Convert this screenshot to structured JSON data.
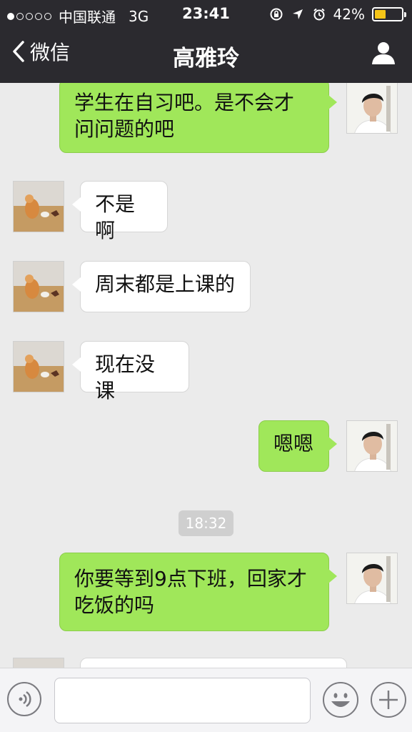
{
  "status_bar": {
    "carrier": "中国联通",
    "network": "3G",
    "time": "23:41",
    "battery": "42%",
    "battery_level": 0.42
  },
  "nav": {
    "back_label": "微信",
    "title": "高雅玲"
  },
  "messages": [
    {
      "side": "out",
      "text_lines": [
        "学生在自习吧。是不会才",
        "问问题的吧"
      ]
    },
    {
      "side": "in",
      "text": "不是啊"
    },
    {
      "side": "in",
      "text": "周末都是上课的"
    },
    {
      "side": "in",
      "text": "现在没课"
    },
    {
      "side": "out",
      "text": "嗯嗯"
    },
    {
      "side": "out",
      "text_lines": [
        "你要等到9点下班，回家才",
        "吃饭的吗"
      ]
    }
  ],
  "timestamp": "18:32",
  "input": {
    "value": "",
    "placeholder": ""
  },
  "colors": {
    "nav_bg": "#2b2a2f",
    "chat_bg": "#ebebeb",
    "bubble_out": "#a0e75a",
    "bubble_in": "#ffffff",
    "battery_fill": "#f5c518"
  }
}
